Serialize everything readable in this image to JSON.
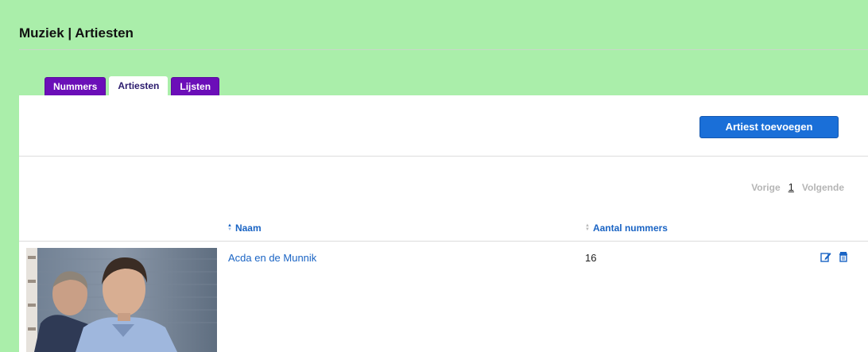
{
  "page": {
    "title": "Muziek | Artiesten"
  },
  "tabs": [
    {
      "label": "Nummers",
      "active": false
    },
    {
      "label": "Artiesten",
      "active": true
    },
    {
      "label": "Lijsten",
      "active": false
    }
  ],
  "toolbar": {
    "add_label": "Artiest toevoegen"
  },
  "pager": {
    "prev": "Vorige",
    "current": "1",
    "next": "Volgende"
  },
  "table": {
    "columns": [
      {
        "label": "Naam",
        "sort": "asc"
      },
      {
        "label": "Aantal nummers",
        "sort": "none"
      }
    ],
    "rows": [
      {
        "name": "Acda en de Munnik",
        "count": "16",
        "photo_icon": "artist-photo"
      }
    ]
  },
  "icons": {
    "edit": "edit-icon",
    "delete": "trash-icon"
  },
  "colors": {
    "background": "#aaeeaa",
    "tab": "#6b0eb8",
    "accent": "#1a6fd8",
    "link": "#1a64c4"
  }
}
